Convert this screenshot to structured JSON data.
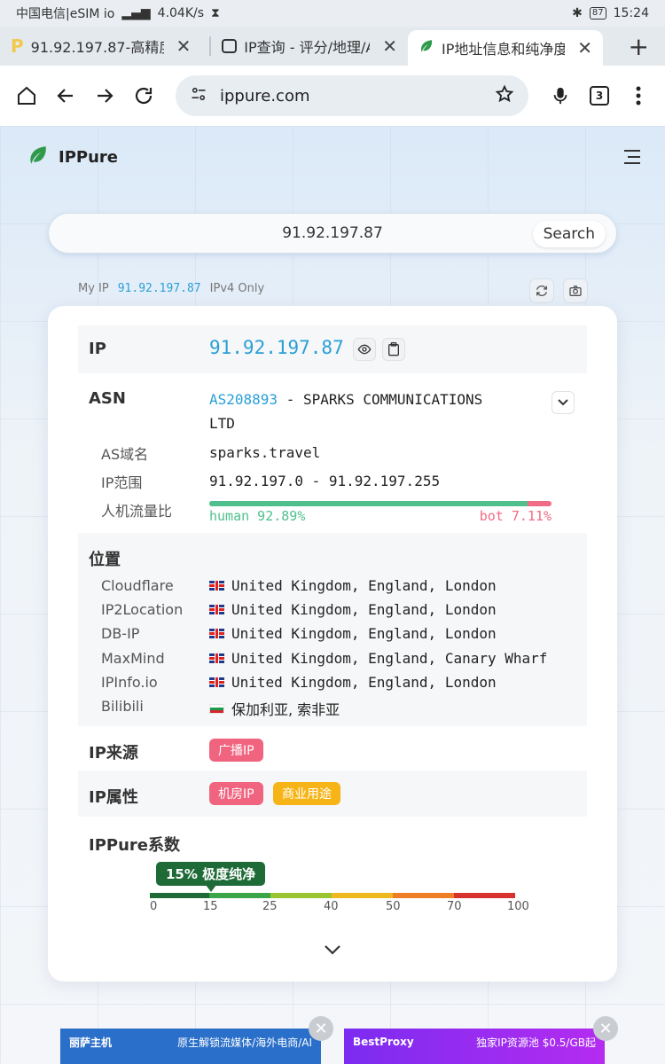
{
  "status": {
    "carrier": "中国电信|eSIM io",
    "speed": "4.04K/s",
    "battery": "87",
    "time": "15:24"
  },
  "tabs": [
    {
      "title": "91.92.197.87-高精度"
    },
    {
      "title": "IP查询 - 评分/地理/A"
    },
    {
      "title": "IP地址信息和纯净度"
    }
  ],
  "toolbar": {
    "url": "ippure.com",
    "tab_count": "3"
  },
  "site": {
    "name": "IPPure",
    "search_value": "91.92.197.87",
    "search_label": "Search"
  },
  "myip": {
    "label": "My IP",
    "value": "91.92.197.87",
    "mode": "IPv4 Only"
  },
  "card": {
    "ip_label": "IP",
    "ip_value": "91.92.197.87",
    "asn_label": "ASN",
    "asn_number": "AS208893",
    "asn_name_line1": " - SPARKS COMMUNICATIONS",
    "asn_name_line2": "LTD",
    "as_domain_label": "AS域名",
    "as_domain": "sparks.travel",
    "ip_range_label": "IP范围",
    "ip_range": "91.92.197.0 - 91.92.197.255",
    "traffic_label": "人机流量比",
    "human_text": "human 92.89%",
    "bot_text": "bot 7.11%",
    "human_fraction": 0.9289,
    "location_label": "位置",
    "locations": [
      {
        "source": "Cloudflare",
        "value": "United Kingdom, England, London"
      },
      {
        "source": "IP2Location",
        "value": "United Kingdom, England, London"
      },
      {
        "source": "DB-IP",
        "value": "United Kingdom, England, London"
      },
      {
        "source": "MaxMind",
        "value": "United Kingdom, England, Canary Wharf"
      },
      {
        "source": "IPInfo.io",
        "value": "United Kingdom, England, London"
      },
      {
        "source": "Bilibili",
        "value": "保加利亚, 索非亚"
      }
    ],
    "source_label": "IP来源",
    "source_tag": "广播IP",
    "attr_label": "IP属性",
    "attr_tags": [
      "机房IP",
      "商业用途"
    ],
    "score_label": "IPPure系数",
    "score_text": "15% 极度纯净",
    "score_value": 15,
    "scale_ticks": [
      "0",
      "15",
      "25",
      "40",
      "50",
      "70",
      "100"
    ]
  },
  "ads": [
    {
      "brand": "丽萨主机",
      "tagline": "原生解锁流媒体/海外电商/AI"
    },
    {
      "brand": "BestProxy",
      "tagline": "独家IP资源池  $0.5/GB起"
    }
  ],
  "colors": {
    "link": "#2a9fd6",
    "human": "#4fc08d",
    "bot": "#f06b85",
    "tag_pink": "#f0647f",
    "tag_orange": "#f6b416",
    "score_green": "#1e6b37"
  }
}
